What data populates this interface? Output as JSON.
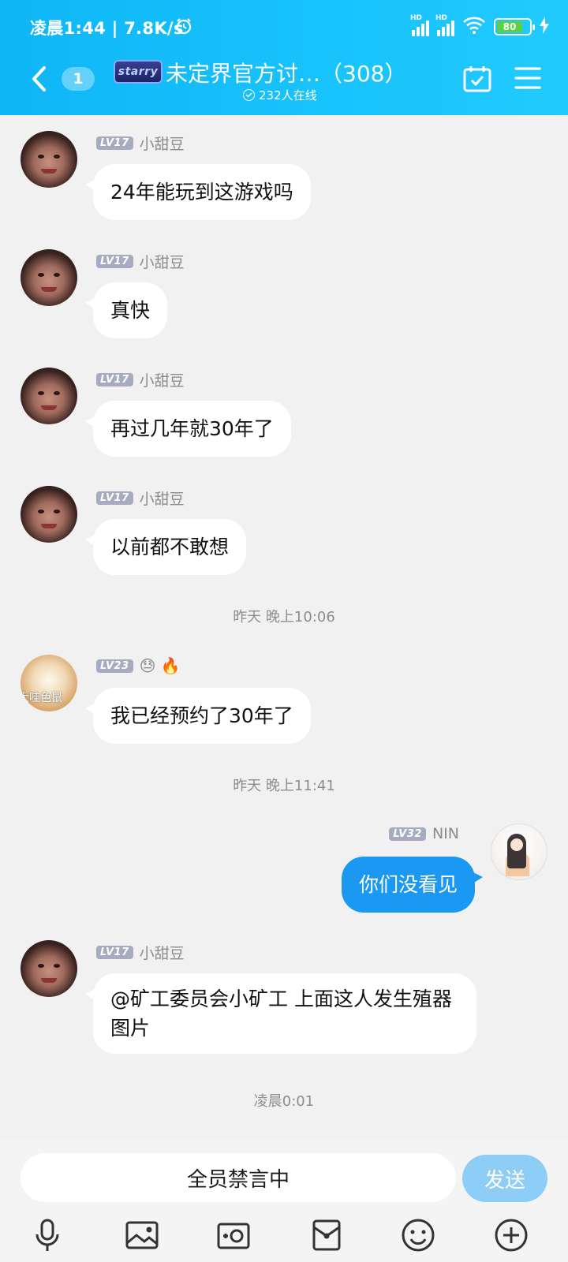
{
  "status_bar": {
    "time": "凌晨1:44 | 7.8K/s",
    "network_type": "HD",
    "battery": "80"
  },
  "header": {
    "unread_count": "1",
    "group_logo_text": "starry",
    "group_name": "未定界官方讨…（308）",
    "online_count": "232人在线"
  },
  "messages": [
    {
      "sender": "小甜豆",
      "level": "LV17",
      "text": "24年能玩到这游戏吗"
    },
    {
      "sender": "小甜豆",
      "level": "LV17",
      "text": "真快"
    },
    {
      "sender": "小甜豆",
      "level": "LV17",
      "text": "再过几年就30年了"
    },
    {
      "sender": "小甜豆",
      "level": "LV17",
      "text": "以前都不敢想"
    },
    {
      "sender": "",
      "level": "LV23",
      "badges": "😓 🔥",
      "avatar_text": "大哇色鼠",
      "text": "我已经预约了30年了"
    },
    {
      "sender": "NIN",
      "level": "LV32",
      "text": "你们没看见"
    },
    {
      "sender": "小甜豆",
      "level": "LV17",
      "text": "@矿工委员会小矿工 上面这人发生殖器图片"
    }
  ],
  "timestamps": [
    "昨天 晚上10:06",
    "昨天 晚上11:41",
    "凌晨0:01"
  ],
  "input": {
    "muted_text": "全员禁言中",
    "send_label": "发送"
  },
  "colors": {
    "header_gradient_start": "#0fb6f6",
    "header_gradient_end": "#21cbff",
    "my_bubble": "#1b98f2",
    "send_disabled": "#8dcdf6"
  }
}
